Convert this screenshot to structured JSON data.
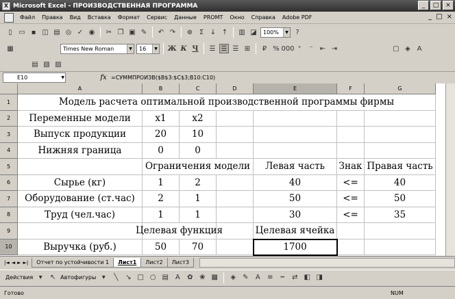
{
  "window": {
    "title": "Microsoft Excel - ПРОИЗВОДСТВЕННАЯ ПРОГРАММА",
    "minimize": "_",
    "restore": "□",
    "close": "×"
  },
  "menu": {
    "items": [
      "Файл",
      "Правка",
      "Вид",
      "Вставка",
      "Формат",
      "Сервис",
      "Данные",
      "PROMT",
      "Окно",
      "Справка",
      "Adobe PDF"
    ],
    "doc_minimize": "_",
    "doc_restore": "□",
    "doc_close": "×"
  },
  "toolbar": {
    "zoom": "100%",
    "font_name": "Times New Roman",
    "font_size": "16",
    "bold": "Ж",
    "italic": "К",
    "underline": "Ч"
  },
  "formula_bar": {
    "name_box": "E10",
    "fx": "fx",
    "formula": "=СУММПРОИЗВ($B$3:$C$3;B10:C10)"
  },
  "columns": [
    "A",
    "B",
    "C",
    "D",
    "E",
    "F",
    "G"
  ],
  "rows": [
    "1",
    "2",
    "3",
    "4",
    "5",
    "6",
    "7",
    "8",
    "9",
    "10"
  ],
  "cells": {
    "A1": "Модель расчета оптимальной производственной программы фирмы",
    "A2": "Переменные модели",
    "B2": "x1",
    "C2": "x2",
    "A3": "Выпуск продукции",
    "B3": "20",
    "C3": "10",
    "A4": "Нижняя граница",
    "B4": "0",
    "C4": "0",
    "B5": "Ограничения модели",
    "E5": "Левая часть",
    "F5": "Знак",
    "G5": "Правая часть",
    "A6": "Сырье (кг)",
    "B6": "1",
    "C6": "2",
    "E6": "40",
    "F6": "<=",
    "G6": "40",
    "A7": "Оборудование (ст.час)",
    "B7": "2",
    "C7": "1",
    "E7": "50",
    "F7": "<=",
    "G7": "50",
    "A8": "Труд (чел.час)",
    "B8": "1",
    "C8": "1",
    "E8": "30",
    "F8": "<=",
    "G8": "35",
    "B9": "Целевая функция",
    "E9": "Целевая ячейка",
    "A10": "Выручка (руб.)",
    "B10": "50",
    "C10": "70",
    "E10": "1700"
  },
  "sheet_tabs": {
    "nav": [
      "|◄",
      "◄",
      "►",
      "►|"
    ],
    "tabs": [
      "Отчет по устойчивости 1",
      "Лист1",
      "Лист2",
      "Лист3"
    ],
    "active": "Лист1"
  },
  "drawing_toolbar": {
    "actions": "Действия",
    "autoshapes": "Автофигуры"
  },
  "status": {
    "ready": "Готово",
    "num": "NUM"
  }
}
